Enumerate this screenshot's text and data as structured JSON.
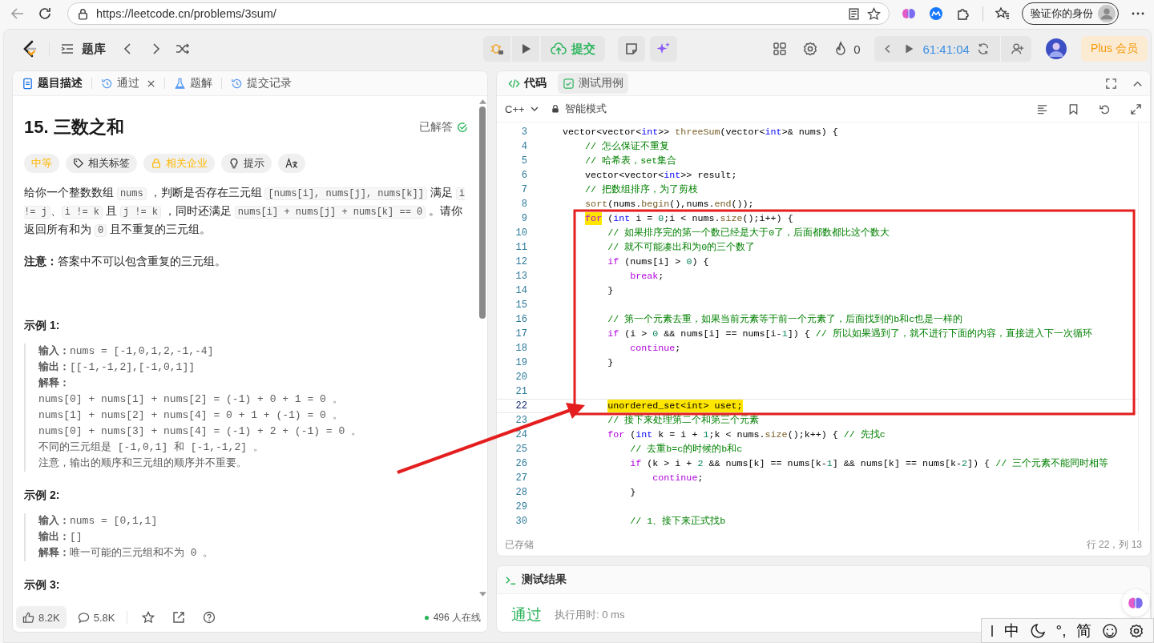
{
  "browser": {
    "url": "https://leetcode.cn/problems/3sum/",
    "profile_label": "验证你的身份"
  },
  "nav": {
    "problem_list": "题库",
    "submit": "提交",
    "streak": "0",
    "timer": "61:41:04",
    "plus": "Plus 会员"
  },
  "left_tabs": [
    {
      "label": "题目描述",
      "selected": true,
      "closable": false
    },
    {
      "label": "通过",
      "selected": false,
      "closable": true
    },
    {
      "label": "题解",
      "selected": false,
      "closable": false
    },
    {
      "label": "提交记录",
      "selected": false,
      "closable": false
    }
  ],
  "problem": {
    "title": "15. 三数之和",
    "status": "已解答",
    "tags": [
      {
        "label": "中等",
        "kind": "difficulty"
      },
      {
        "label": "相关标签",
        "kind": "tag"
      },
      {
        "label": "相关企业",
        "kind": "company"
      },
      {
        "label": "提示",
        "kind": "hint"
      }
    ],
    "description": [
      {
        "kind": "text",
        "text": "给你一个整数数组 "
      },
      {
        "kind": "code",
        "text": "nums"
      },
      {
        "kind": "text",
        "text": " ，判断是否存在三元组 "
      },
      {
        "kind": "code",
        "text": "[nums[i], nums[j], nums[k]]"
      },
      {
        "kind": "text",
        "text": " 满足 "
      },
      {
        "kind": "code",
        "text": "i != j"
      },
      {
        "kind": "text",
        "text": "、"
      },
      {
        "kind": "code",
        "text": "i != k"
      },
      {
        "kind": "text",
        "text": " 且 "
      },
      {
        "kind": "code",
        "text": "j != k"
      },
      {
        "kind": "text",
        "text": " ，同时还满足 "
      },
      {
        "kind": "code",
        "text": "nums[i] + nums[j] + nums[k] == 0"
      },
      {
        "kind": "text",
        "text": " 。请你返回所有和为 "
      },
      {
        "kind": "code",
        "text": "0"
      },
      {
        "kind": "text",
        "text": " 且不重复的三元组。"
      }
    ],
    "note": "**注意：**答案中不可以包含重复的三元组。",
    "examples": [
      {
        "title": "示例 1:",
        "lines": [
          "**输入：**nums = [-1,0,1,2,-1,-4]",
          "**输出：**[[-1,-1,2],[-1,0,1]]",
          "**解释：**",
          "nums[0] + nums[1] + nums[2] = (-1) + 0 + 1 = 0 。",
          "nums[1] + nums[2] + nums[4] = 0 + 1 + (-1) = 0 。",
          "nums[0] + nums[3] + nums[4] = (-1) + 2 + (-1) = 0 。",
          "不同的三元组是 [-1,0,1] 和 [-1,-1,2] 。",
          "注意，输出的顺序和三元组的顺序并不重要。"
        ]
      },
      {
        "title": "示例 2:",
        "lines": [
          "**输入：**nums = [0,1,1]",
          "**输出：**[]",
          "**解释：**唯一可能的三元组和不为 0 。"
        ]
      },
      {
        "title": "示例 3:"
      }
    ]
  },
  "footer": {
    "likes": "8.2K",
    "comments": "5.8K",
    "online": "496 人在线"
  },
  "editor": {
    "tabs": [
      {
        "label": "代码",
        "selected": true
      },
      {
        "label": "测试用例",
        "selected": false
      }
    ],
    "language": "C++",
    "mode": "智能模式",
    "saved": "已存储",
    "cursor": "行 22，列 13",
    "lines": [
      {
        "number": "3",
        "current": false,
        "tokens": [
          {
            "kind": "p",
            "text": "    vector<vector<"
          },
          {
            "kind": "t",
            "text": "int"
          },
          {
            "kind": "p",
            "text": ">> "
          },
          {
            "kind": "f",
            "text": "threeSum"
          },
          {
            "kind": "p",
            "text": "(vector<"
          },
          {
            "kind": "t",
            "text": "int"
          },
          {
            "kind": "p",
            "text": ">& nums) {"
          }
        ]
      },
      {
        "number": "4",
        "current": false,
        "tokens": [
          {
            "kind": "c",
            "text": "        // 怎么保证不重复"
          }
        ]
      },
      {
        "number": "5",
        "current": false,
        "tokens": [
          {
            "kind": "c",
            "text": "        // 哈希表，set集合"
          }
        ]
      },
      {
        "number": "6",
        "current": false,
        "tokens": [
          {
            "kind": "p",
            "text": "        vector<vector<"
          },
          {
            "kind": "t",
            "text": "int"
          },
          {
            "kind": "p",
            "text": ">> result;"
          }
        ]
      },
      {
        "number": "7",
        "current": false,
        "tokens": [
          {
            "kind": "c",
            "text": "        // 把数组排序，为了剪枝"
          }
        ]
      },
      {
        "number": "8",
        "current": false,
        "tokens": [
          {
            "kind": "f",
            "text": "        sort"
          },
          {
            "kind": "p",
            "text": "(nums."
          },
          {
            "kind": "f",
            "text": "begin"
          },
          {
            "kind": "p",
            "text": "(),nums."
          },
          {
            "kind": "f",
            "text": "end"
          },
          {
            "kind": "p",
            "text": "());"
          }
        ]
      },
      {
        "number": "9",
        "current": false,
        "tokens": [
          {
            "kind": "kh",
            "text": "        for"
          },
          {
            "kind": "p",
            "text": " ("
          },
          {
            "kind": "t",
            "text": "int"
          },
          {
            "kind": "p",
            "text": " i = "
          },
          {
            "kind": "n",
            "text": "0"
          },
          {
            "kind": "p",
            "text": ";i < nums."
          },
          {
            "kind": "f",
            "text": "size"
          },
          {
            "kind": "p",
            "text": "();i++) {"
          }
        ]
      },
      {
        "number": "10",
        "current": false,
        "tokens": [
          {
            "kind": "c",
            "text": "            // 如果排序完的第一个数已经是大于0了，后面都数都比这个数大"
          }
        ]
      },
      {
        "number": "11",
        "current": false,
        "tokens": [
          {
            "kind": "c",
            "text": "            // 就不可能凑出和为0的三个数了"
          }
        ]
      },
      {
        "number": "12",
        "current": false,
        "tokens": [
          {
            "kind": "k",
            "text": "            if"
          },
          {
            "kind": "p",
            "text": " (nums[i] > "
          },
          {
            "kind": "n",
            "text": "0"
          },
          {
            "kind": "p",
            "text": ") {"
          }
        ]
      },
      {
        "number": "13",
        "current": false,
        "tokens": [
          {
            "kind": "k",
            "text": "                break"
          },
          {
            "kind": "p",
            "text": ";"
          }
        ]
      },
      {
        "number": "14",
        "current": false,
        "tokens": [
          {
            "kind": "p",
            "text": "            }"
          }
        ]
      },
      {
        "number": "15",
        "current": false
      },
      {
        "number": "16",
        "current": false,
        "tokens": [
          {
            "kind": "c",
            "text": "            // 第一个元素去重，如果当前元素等于前一个元素了，后面找到的b和c也是一样的"
          }
        ]
      },
      {
        "number": "17",
        "current": false,
        "tokens": [
          {
            "kind": "k",
            "text": "            if"
          },
          {
            "kind": "p",
            "text": " (i > "
          },
          {
            "kind": "n",
            "text": "0"
          },
          {
            "kind": "p",
            "text": " && nums[i] == nums[i-"
          },
          {
            "kind": "n",
            "text": "1"
          },
          {
            "kind": "p",
            "text": "]) { "
          },
          {
            "kind": "c",
            "text": "// 所以如果遇到了，就不进行下面的内容，直接进入下一次循环"
          }
        ]
      },
      {
        "number": "18",
        "current": false,
        "tokens": [
          {
            "kind": "k",
            "text": "                continue"
          },
          {
            "kind": "p",
            "text": ";"
          }
        ]
      },
      {
        "number": "19",
        "current": false,
        "tokens": [
          {
            "kind": "p",
            "text": "            }"
          }
        ]
      },
      {
        "number": "20",
        "current": false
      },
      {
        "number": "21",
        "current": false
      },
      {
        "number": "22",
        "current": true,
        "tokens": [
          {
            "kind": "ph",
            "text": "            unordered_set<int> uset;"
          }
        ]
      },
      {
        "number": "23",
        "current": false,
        "tokens": [
          {
            "kind": "c",
            "text": "            // 接下来处理第二个和第三个元素"
          }
        ]
      },
      {
        "number": "24",
        "current": false,
        "tokens": [
          {
            "kind": "k",
            "text": "            for"
          },
          {
            "kind": "p",
            "text": " ("
          },
          {
            "kind": "t",
            "text": "int"
          },
          {
            "kind": "p",
            "text": " k = i + "
          },
          {
            "kind": "n",
            "text": "1"
          },
          {
            "kind": "p",
            "text": ";k < nums."
          },
          {
            "kind": "f",
            "text": "size"
          },
          {
            "kind": "p",
            "text": "();k++) { "
          },
          {
            "kind": "c",
            "text": "// 先找c"
          }
        ]
      },
      {
        "number": "25",
        "current": false,
        "tokens": [
          {
            "kind": "c",
            "text": "                // 去重b=c的时候的b和c"
          }
        ]
      },
      {
        "number": "26",
        "current": false,
        "tokens": [
          {
            "kind": "k",
            "text": "                if"
          },
          {
            "kind": "p",
            "text": " (k > i + "
          },
          {
            "kind": "n",
            "text": "2"
          },
          {
            "kind": "p",
            "text": " && nums[k] == nums[k-"
          },
          {
            "kind": "n",
            "text": "1"
          },
          {
            "kind": "p",
            "text": "] && nums[k] == nums[k-"
          },
          {
            "kind": "n",
            "text": "2"
          },
          {
            "kind": "p",
            "text": "]) { "
          },
          {
            "kind": "c",
            "text": "// 三个元素不能同时相等"
          }
        ]
      },
      {
        "number": "27",
        "current": false,
        "tokens": [
          {
            "kind": "k",
            "text": "                    continue"
          },
          {
            "kind": "p",
            "text": ";"
          }
        ]
      },
      {
        "number": "28",
        "current": false,
        "tokens": [
          {
            "kind": "p",
            "text": "                }"
          }
        ]
      },
      {
        "number": "29",
        "current": false
      },
      {
        "number": "30",
        "current": false,
        "tokens": [
          {
            "kind": "c",
            "text": "                // 1、接下来正式找b"
          }
        ]
      }
    ]
  },
  "results": {
    "title": "测试结果",
    "verdict": "通过",
    "runtime": "执行用时: 0 ms"
  },
  "ime": {
    "items": [
      "中",
      "°,",
      "简"
    ]
  }
}
